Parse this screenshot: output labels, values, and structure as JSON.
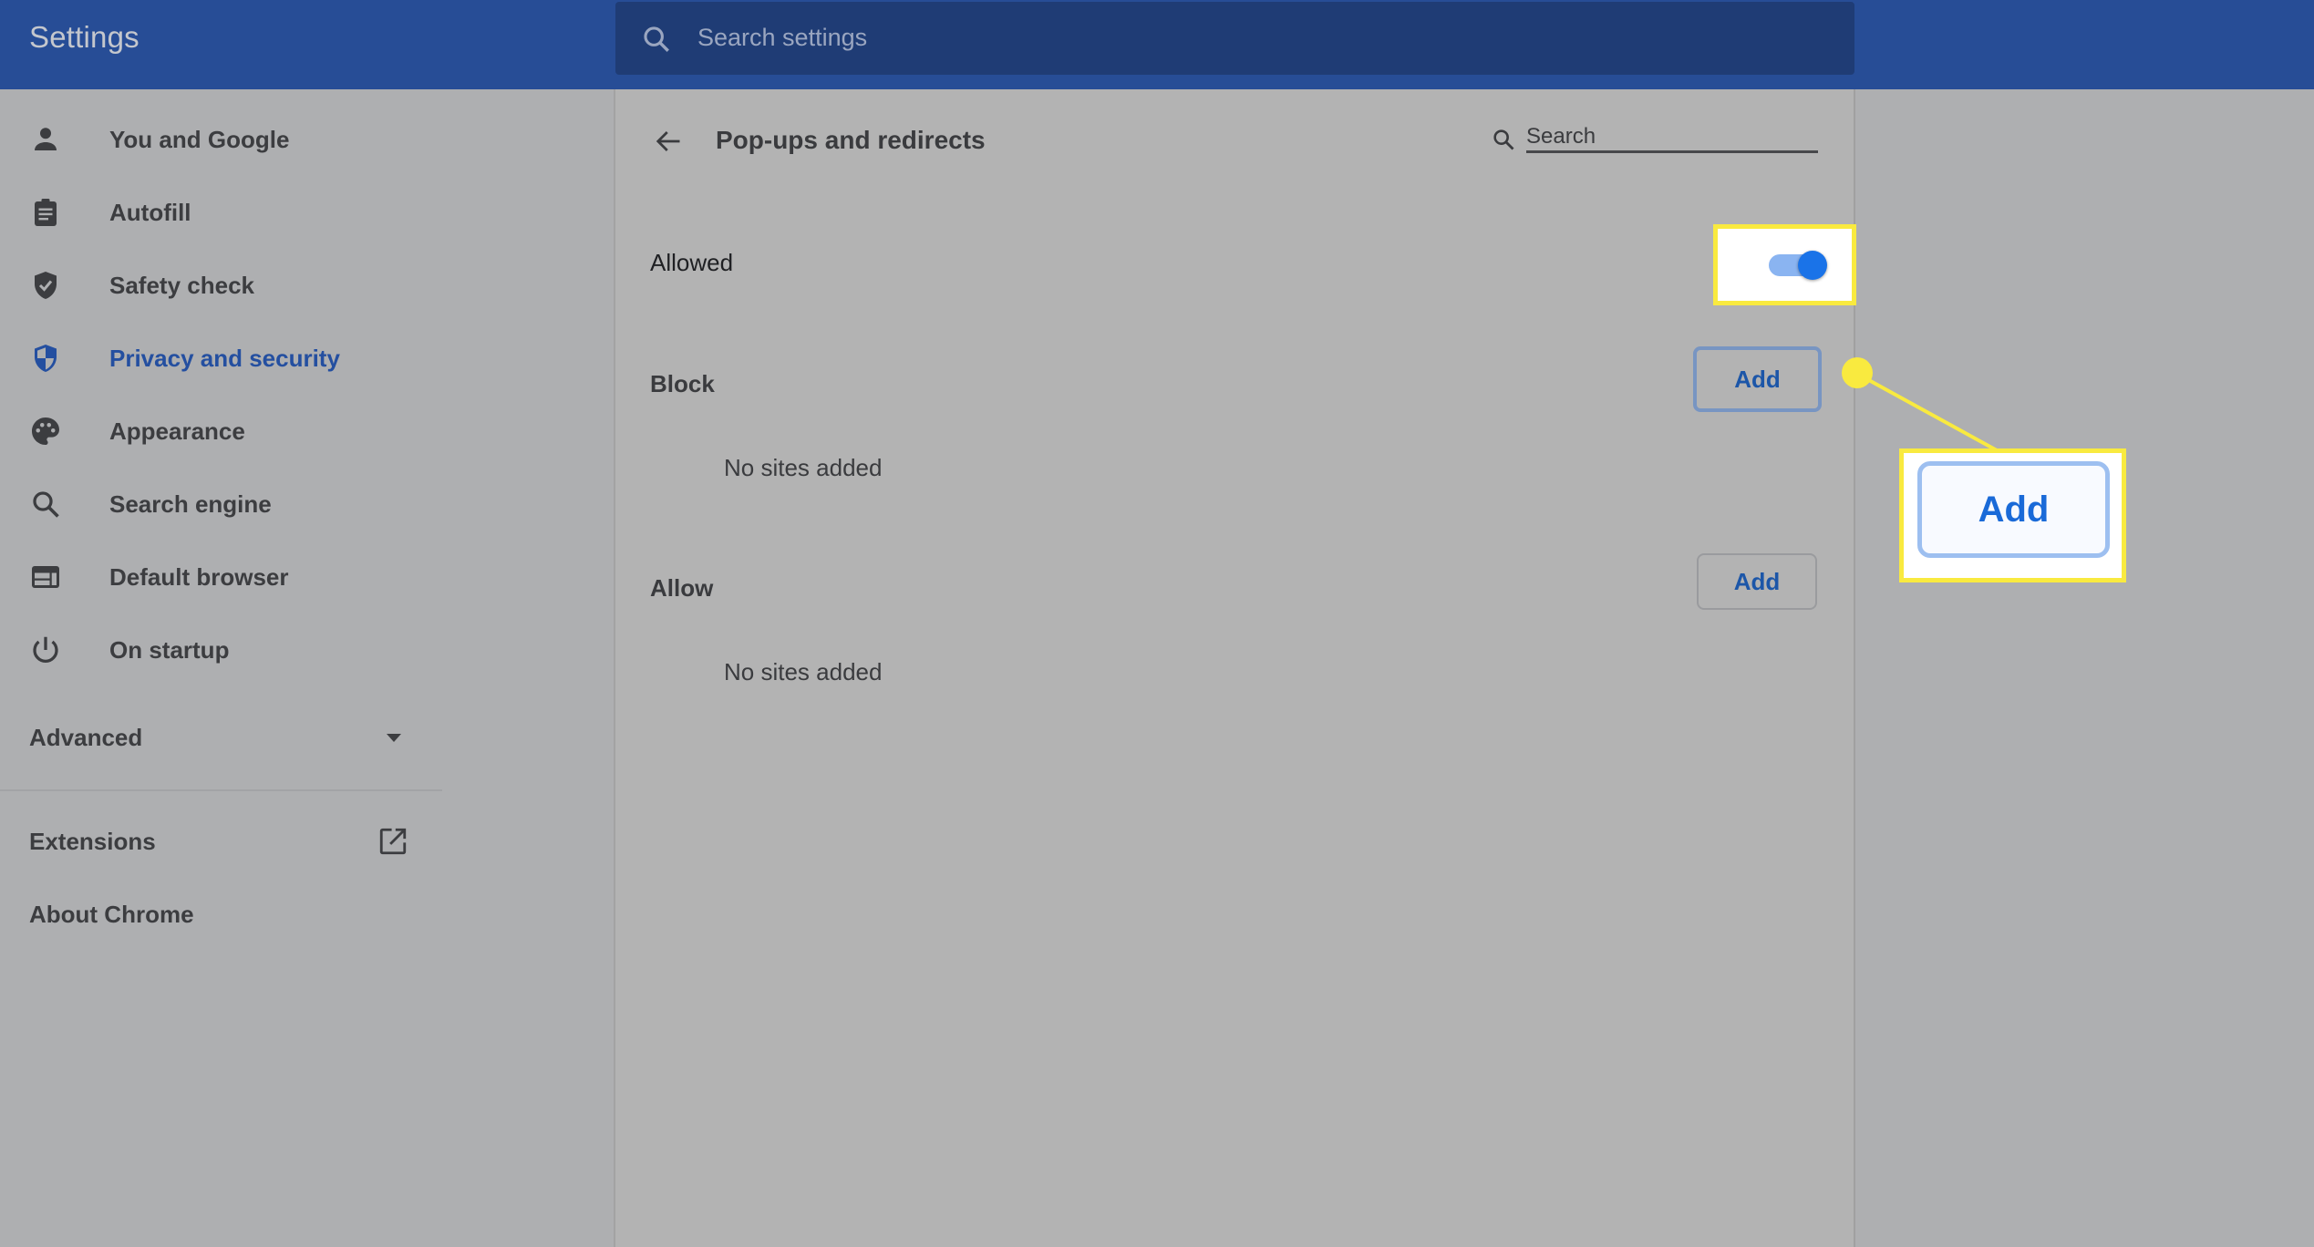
{
  "header": {
    "title": "Settings",
    "search_placeholder": "Search settings",
    "search_icon": "search-icon"
  },
  "sidebar": {
    "items": [
      {
        "label": "You and Google",
        "icon": "person-icon",
        "active": false
      },
      {
        "label": "Autofill",
        "icon": "clipboard-icon",
        "active": false
      },
      {
        "label": "Safety check",
        "icon": "shield-check-icon",
        "active": false
      },
      {
        "label": "Privacy and security",
        "icon": "shield-privacy-icon",
        "active": true
      },
      {
        "label": "Appearance",
        "icon": "palette-icon",
        "active": false
      },
      {
        "label": "Search engine",
        "icon": "search-icon",
        "active": false
      },
      {
        "label": "Default browser",
        "icon": "browser-icon",
        "active": false
      },
      {
        "label": "On startup",
        "icon": "power-icon",
        "active": false
      }
    ],
    "advanced_label": "Advanced",
    "extensions_label": "Extensions",
    "about_label": "About Chrome"
  },
  "main": {
    "back_icon": "arrow-back-icon",
    "page_title": "Pop-ups and redirects",
    "search_placeholder": "Search",
    "allowed_label": "Allowed",
    "allowed_toggle_on": true,
    "block": {
      "heading": "Block",
      "add_label": "Add",
      "empty_text": "No sites added"
    },
    "allow": {
      "heading": "Allow",
      "add_label": "Add",
      "empty_text": "No sites added"
    }
  },
  "annotation": {
    "callout_label": "Add",
    "highlight_color": "#f9ea3f"
  },
  "colors": {
    "header_bg": "#274d96",
    "accent": "#1a73e8",
    "active_nav": "#244fa0"
  }
}
